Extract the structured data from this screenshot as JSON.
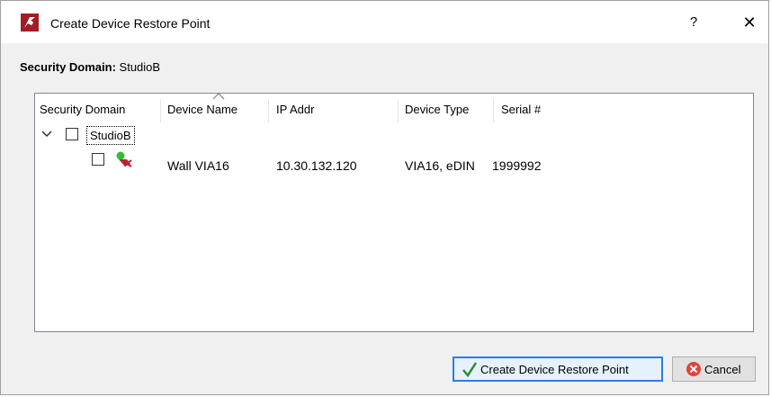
{
  "window": {
    "title": "Create Device Restore Point",
    "help_glyph": "?",
    "close_glyph": "✕"
  },
  "security_domain": {
    "label": "Security Domain:",
    "value": "StudioB"
  },
  "tree": {
    "columns": [
      "Security Domain",
      "Device Name",
      "IP Addr",
      "Device Type",
      "Serial #"
    ],
    "sorted_column": "Device Name",
    "group": {
      "name": "StudioB",
      "expanded": true,
      "checked": false
    },
    "rows": [
      {
        "checked": false,
        "device_name": "Wall VIA16",
        "ip_addr": "10.30.132.120",
        "device_type": "VIA16, eDIN",
        "serial": "1999992"
      }
    ]
  },
  "buttons": {
    "create_label": "Create Device Restore Point",
    "cancel_label": "Cancel"
  },
  "colors": {
    "accent": "#2b7ee6",
    "app_icon": "#a51c24",
    "ok_check": "#2e8b2e",
    "cancel_icon": "#e0433a"
  }
}
